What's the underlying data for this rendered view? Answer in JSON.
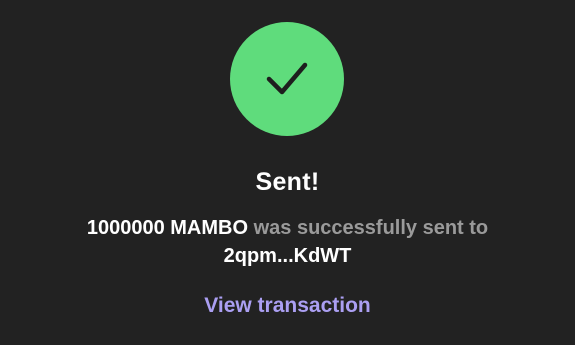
{
  "status": {
    "icon": "checkmark-icon",
    "circle_color": "#5fdc7c",
    "title": "Sent!"
  },
  "message": {
    "amount": "1000000 MAMBO",
    "middle_text": " was successfully sent to ",
    "recipient": "2qpm...KdWT"
  },
  "actions": {
    "view_transaction_label": "View transaction",
    "link_color": "#ab9ff2"
  }
}
